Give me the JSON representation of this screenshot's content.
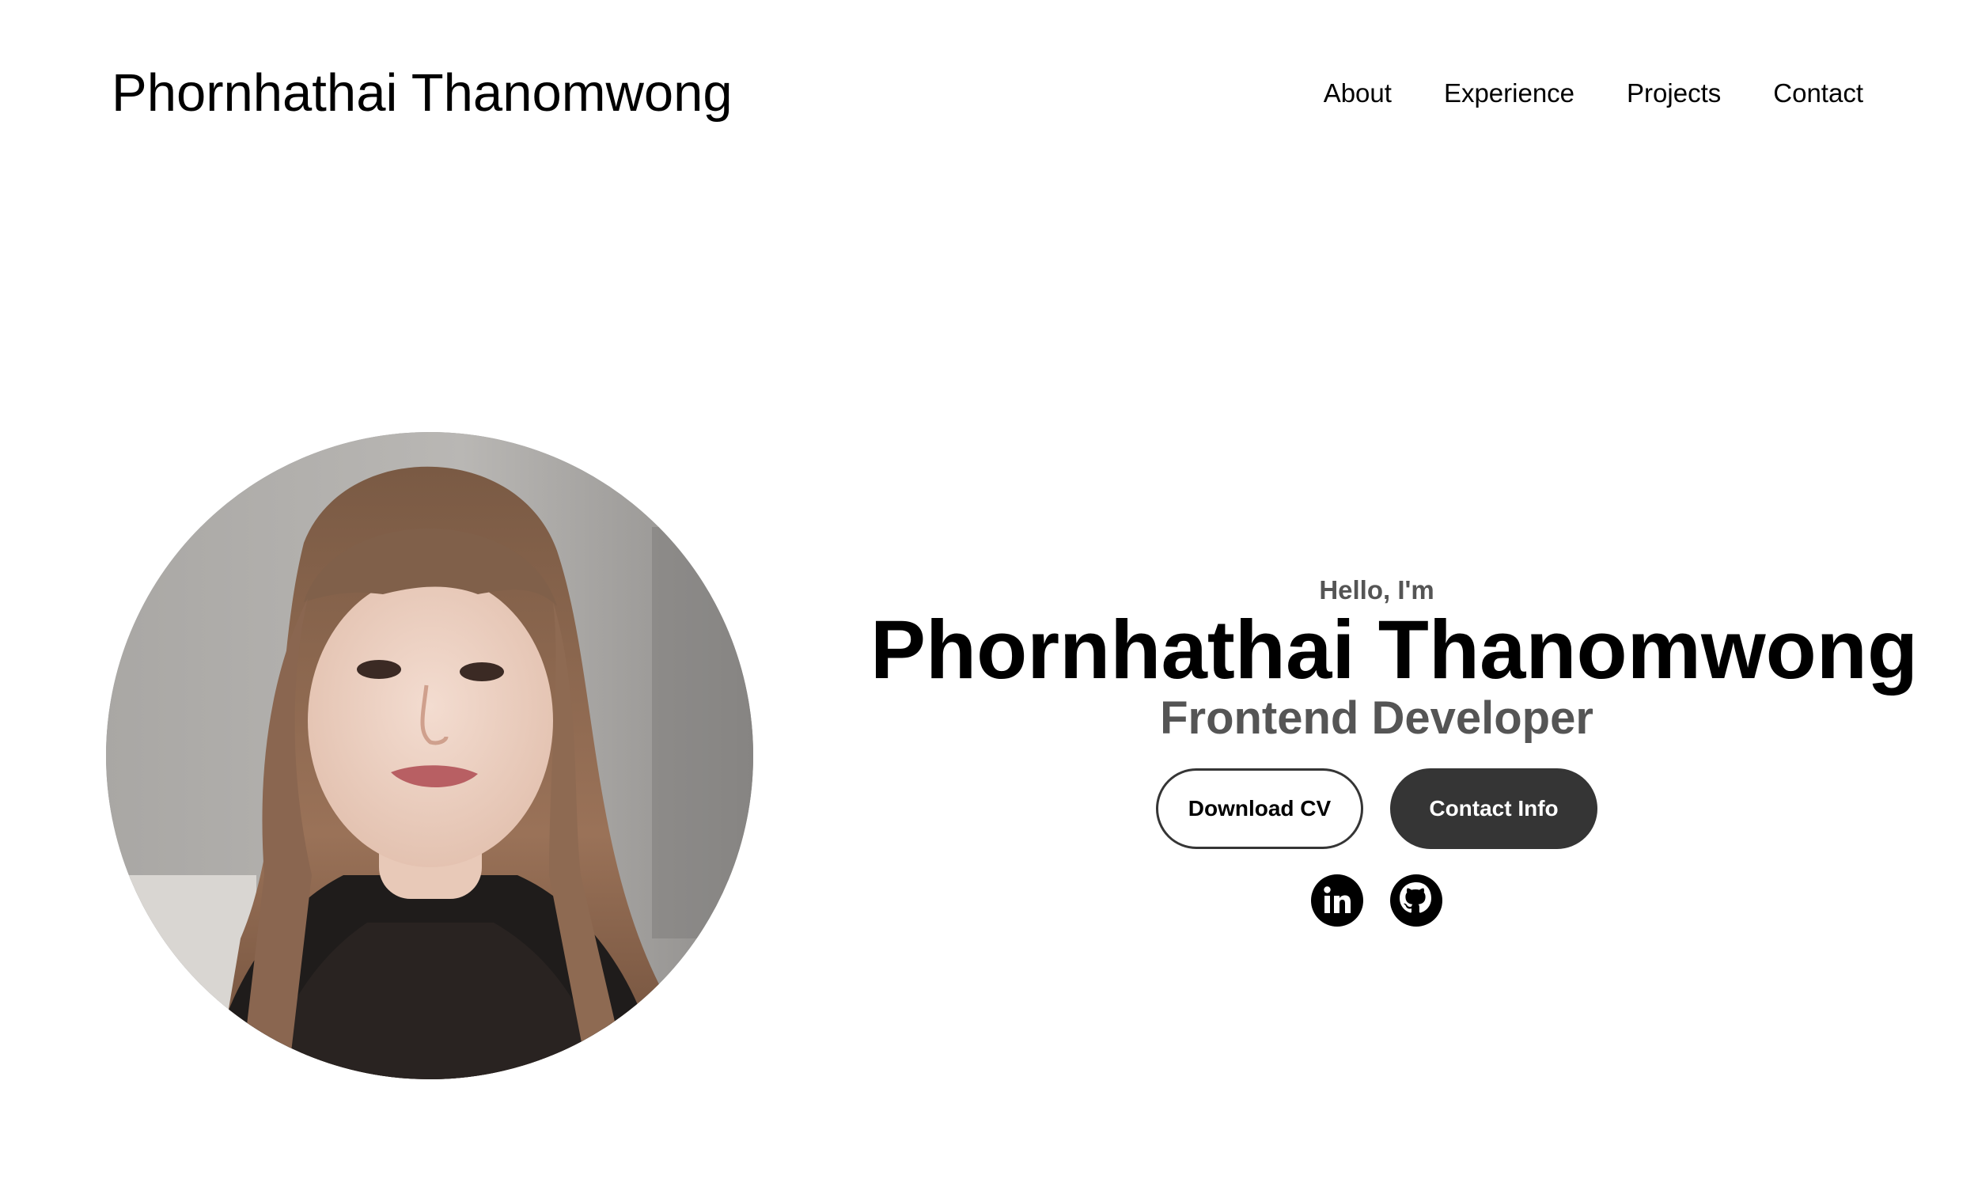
{
  "header": {
    "logo_text": "Phornhathai Thanomwong",
    "nav": [
      {
        "label": "About"
      },
      {
        "label": "Experience"
      },
      {
        "label": "Projects"
      },
      {
        "label": "Contact"
      }
    ]
  },
  "hero": {
    "greeting": "Hello, I'm",
    "name": "Phornhathai Thanomwong",
    "role": "Frontend Developer",
    "buttons": {
      "download_cv": "Download CV",
      "contact_info": "Contact Info"
    },
    "socials": [
      {
        "icon": "linkedin-icon"
      },
      {
        "icon": "github-icon"
      }
    ]
  },
  "colors": {
    "text": "#000000",
    "muted": "#555555",
    "button_dark": "#353535",
    "background": "#ffffff"
  }
}
